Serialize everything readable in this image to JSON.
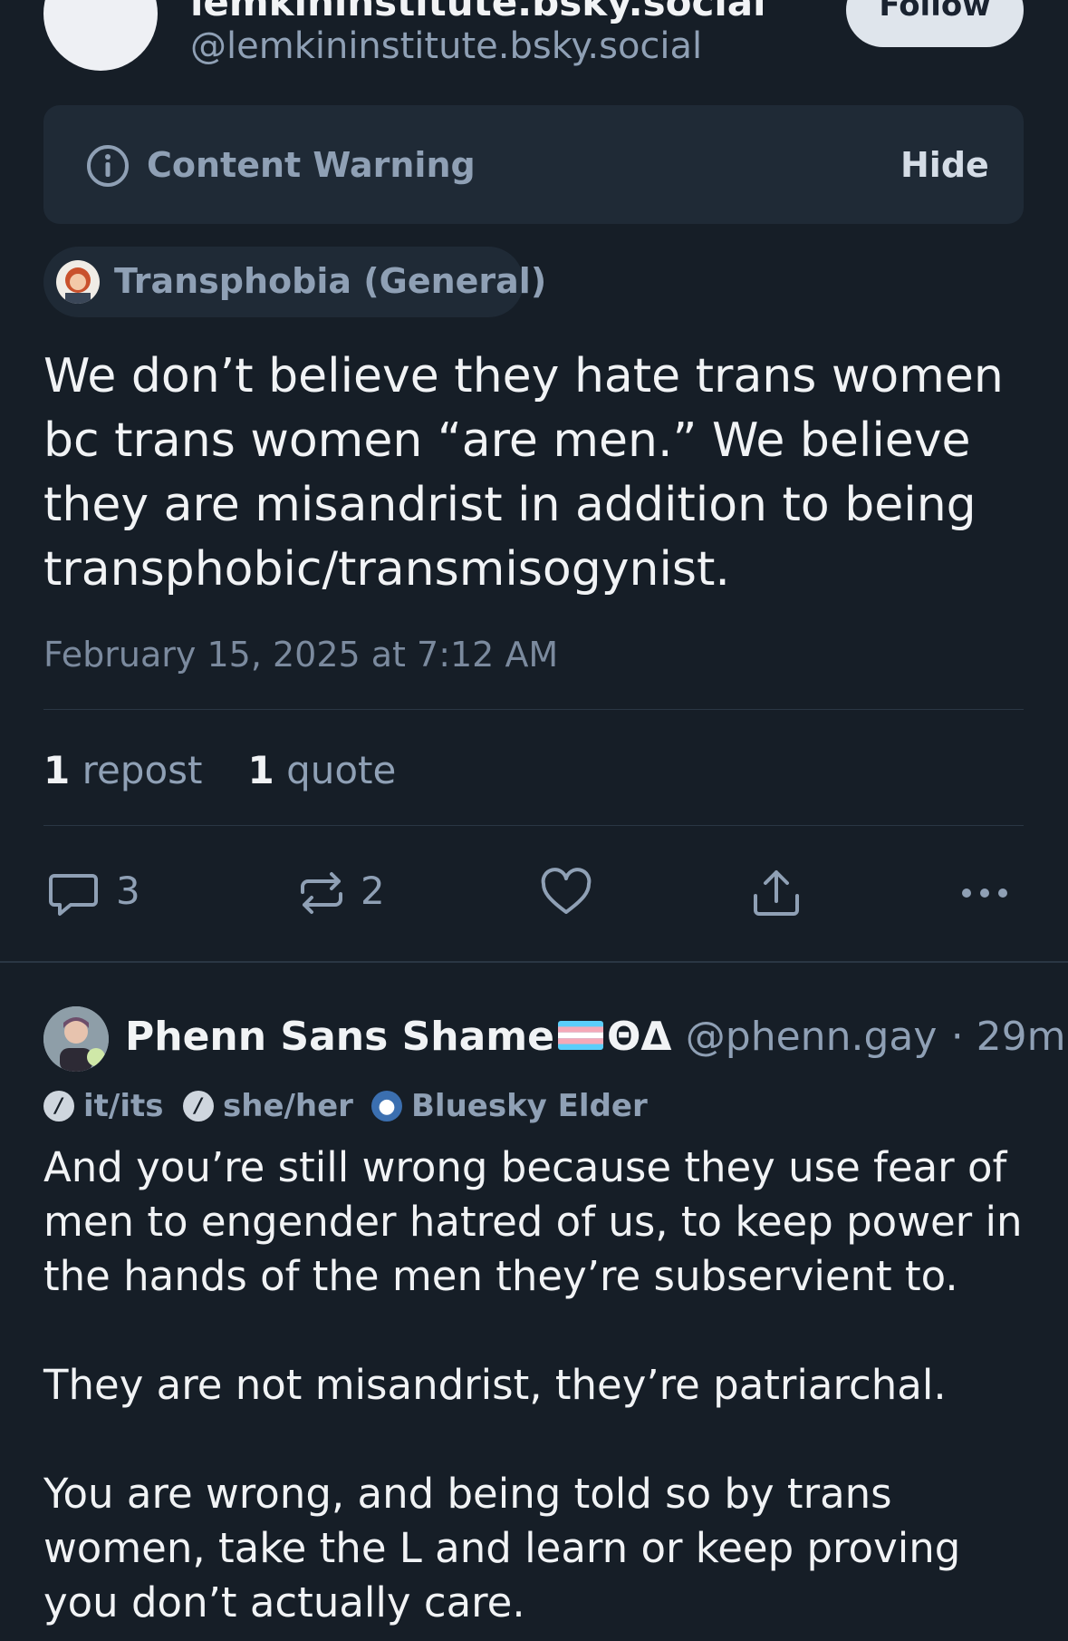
{
  "author": {
    "display_name": "lemkininstitute.bsky.social",
    "handle": "@lemkininstitute.bsky.social",
    "follow_label": "Follow"
  },
  "content_warning": {
    "label": "Content Warning",
    "hide_label": "Hide"
  },
  "label_chip": "Transphobia (General)",
  "post": {
    "text": "We don’t believe they hate trans women bc trans women “are men.” We believe they are misandrist in addition to being transphobic/transmisogynist.",
    "date": "February 15, 2025 at 7:12 AM",
    "reposts_count": "1",
    "reposts_label": "repost",
    "quotes_count": "1",
    "quotes_label": "quote"
  },
  "actions": {
    "reply_count": "3",
    "repost_count": "2",
    "like_icon": "heart-icon",
    "share_icon": "share-icon",
    "more_icon": "more-icon"
  },
  "reply": {
    "display_name": "Phenn Sans Shame",
    "suffix": "ΘΔ",
    "handle": "@phenn.gay",
    "time": "· 29m",
    "pronoun1": "it/its",
    "pronoun2": "she/her",
    "badge": "Bluesky Elder",
    "text": "And you’re still wrong because they use fear of men to engender hatred of us, to keep power in the hands of the men they’re subservient to.\n\nThey are not misandrist, they’re patriarchal.\n\nYou are wrong, and being told so by trans women, take the L and learn or keep proving you don’t actually care."
  },
  "colors": {
    "background": "#161e27",
    "muted_text": "#8fa0b5",
    "panel": "#1f2a36"
  }
}
